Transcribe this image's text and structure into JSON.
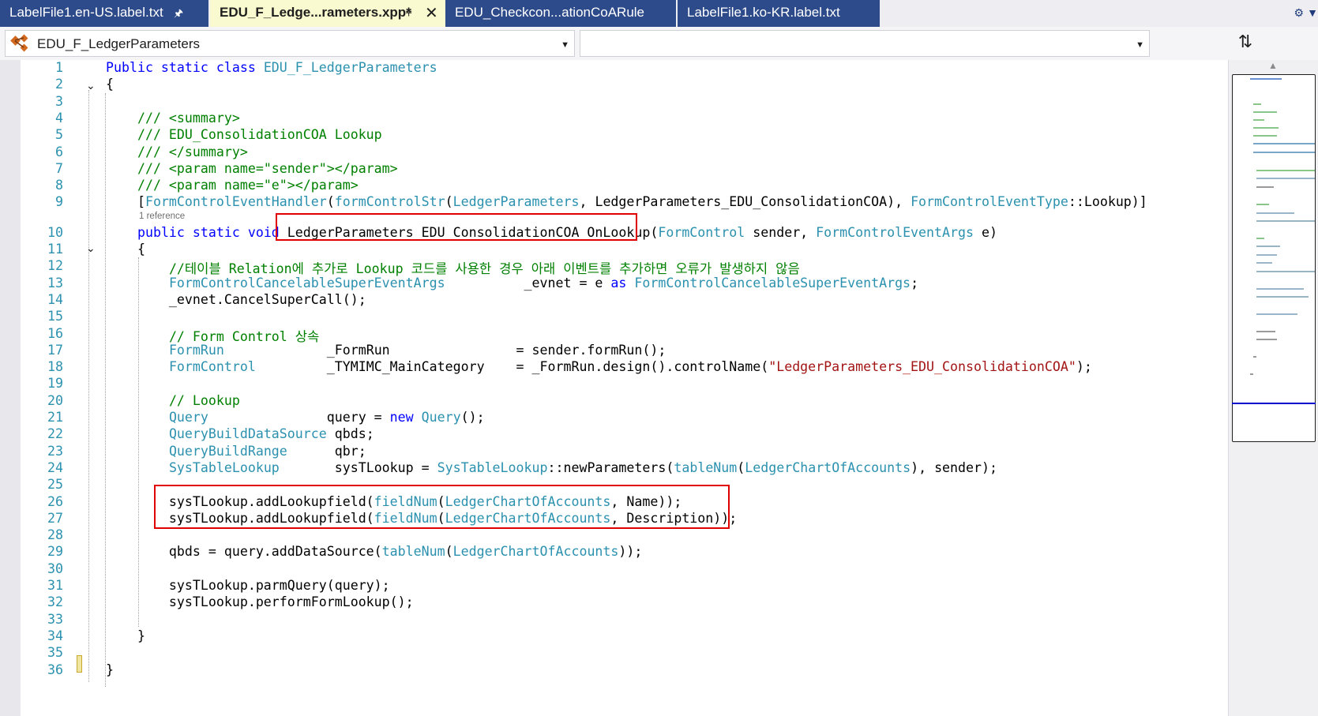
{
  "tabs": [
    {
      "label": "LabelFile1.en-US.label.txt",
      "pinned": true,
      "active": false
    },
    {
      "label": "EDU_F_Ledge...rameters.xpp*",
      "pinned": true,
      "active": true
    },
    {
      "label": "EDU_Checkcon...ationCoARule",
      "pinned": false,
      "active": false
    },
    {
      "label": "LabelFile1.ko-KR.label.txt",
      "pinned": false,
      "active": false
    }
  ],
  "navbar": {
    "type_combo": "EDU_F_LedgerParameters",
    "member_combo": ""
  },
  "code": {
    "reference_label": "1 reference",
    "lines": [
      {
        "n": "1",
        "segs": [
          [
            "kw",
            "Public static class "
          ],
          [
            "ty",
            "EDU_F_LedgerParameters"
          ]
        ]
      },
      {
        "n": "2",
        "segs": [
          [
            "",
            "{"
          ]
        ]
      },
      {
        "n": "3",
        "segs": []
      },
      {
        "n": "4",
        "segs": [
          [
            "",
            "    "
          ],
          [
            "cm",
            "/// <summary>"
          ]
        ]
      },
      {
        "n": "5",
        "segs": [
          [
            "",
            "    "
          ],
          [
            "cm",
            "/// EDU_ConsolidationCOA Lookup"
          ]
        ]
      },
      {
        "n": "6",
        "segs": [
          [
            "",
            "    "
          ],
          [
            "cm",
            "/// </summary>"
          ]
        ]
      },
      {
        "n": "7",
        "segs": [
          [
            "",
            "    "
          ],
          [
            "cm",
            "/// <param name=\"sender\"></param>"
          ]
        ]
      },
      {
        "n": "8",
        "segs": [
          [
            "",
            "    "
          ],
          [
            "cm",
            "/// <param name=\"e\"></param>"
          ]
        ]
      },
      {
        "n": "9",
        "segs": [
          [
            "",
            "    ["
          ],
          [
            "ty",
            "FormControlEventHandler"
          ],
          [
            "",
            "("
          ],
          [
            "ty",
            "formControlStr"
          ],
          [
            "",
            "("
          ],
          [
            "ty",
            "LedgerParameters"
          ],
          [
            "",
            ", LedgerParameters_EDU_ConsolidationCOA), "
          ],
          [
            "ty",
            "FormControlEventType"
          ],
          [
            "",
            "::Lookup)]"
          ]
        ]
      },
      {
        "n": "10",
        "segs": [
          [
            "",
            "    "
          ],
          [
            "kw",
            "public static void "
          ],
          [
            "",
            "LedgerParameters_EDU_ConsolidationCOA_OnLookup("
          ],
          [
            "ty",
            "FormControl"
          ],
          [
            "",
            " sender, "
          ],
          [
            "ty",
            "FormControlEventArgs"
          ],
          [
            "",
            " e)"
          ]
        ]
      },
      {
        "n": "11",
        "segs": [
          [
            "",
            "    {"
          ]
        ]
      },
      {
        "n": "12",
        "segs": [
          [
            "",
            "        "
          ],
          [
            "cm",
            "//테이블 Relation에 추가로 Lookup 코드를 사용한 경우 아래 이벤트를 추가하면 오류가 발생하지 않음"
          ]
        ]
      },
      {
        "n": "13",
        "segs": [
          [
            "",
            "        "
          ],
          [
            "ty",
            "FormControlCancelableSuperEventArgs"
          ],
          [
            "",
            "          _evnet = e "
          ],
          [
            "kw",
            "as "
          ],
          [
            "ty",
            "FormControlCancelableSuperEventArgs"
          ],
          [
            "",
            ";"
          ]
        ]
      },
      {
        "n": "14",
        "segs": [
          [
            "",
            "        _evnet.CancelSuperCall();"
          ]
        ]
      },
      {
        "n": "15",
        "segs": []
      },
      {
        "n": "16",
        "segs": [
          [
            "",
            "        "
          ],
          [
            "cm",
            "// Form Control 상속"
          ]
        ]
      },
      {
        "n": "17",
        "segs": [
          [
            "",
            "        "
          ],
          [
            "ty",
            "FormRun"
          ],
          [
            "",
            "             _FormRun                = sender.formRun();"
          ]
        ]
      },
      {
        "n": "18",
        "segs": [
          [
            "",
            "        "
          ],
          [
            "ty",
            "FormControl"
          ],
          [
            "",
            "         _TYMIMC_MainCategory    = _FormRun.design().controlName("
          ],
          [
            "str",
            "\"LedgerParameters_EDU_ConsolidationCOA\""
          ],
          [
            "",
            ");"
          ]
        ]
      },
      {
        "n": "19",
        "segs": []
      },
      {
        "n": "20",
        "segs": [
          [
            "",
            "        "
          ],
          [
            "cm",
            "// Lookup"
          ]
        ]
      },
      {
        "n": "21",
        "segs": [
          [
            "",
            "        "
          ],
          [
            "ty",
            "Query"
          ],
          [
            "",
            "               query = "
          ],
          [
            "kw",
            "new "
          ],
          [
            "ty",
            "Query"
          ],
          [
            "",
            "();"
          ]
        ]
      },
      {
        "n": "22",
        "segs": [
          [
            "",
            "        "
          ],
          [
            "ty",
            "QueryBuildDataSource"
          ],
          [
            "",
            " qbds;"
          ]
        ]
      },
      {
        "n": "23",
        "segs": [
          [
            "",
            "        "
          ],
          [
            "ty",
            "QueryBuildRange"
          ],
          [
            "",
            "      qbr;"
          ]
        ]
      },
      {
        "n": "24",
        "segs": [
          [
            "",
            "        "
          ],
          [
            "ty",
            "SysTableLookup"
          ],
          [
            "",
            "       sysTLookup = "
          ],
          [
            "ty",
            "SysTableLookup"
          ],
          [
            "",
            "::newParameters("
          ],
          [
            "ty",
            "tableNum"
          ],
          [
            "",
            "("
          ],
          [
            "ty",
            "LedgerChartOfAccounts"
          ],
          [
            "",
            "), sender);"
          ]
        ]
      },
      {
        "n": "25",
        "segs": []
      },
      {
        "n": "26",
        "segs": [
          [
            "",
            "        sysTLookup.addLookupfield("
          ],
          [
            "ty",
            "fieldNum"
          ],
          [
            "",
            "("
          ],
          [
            "ty",
            "LedgerChartOfAccounts"
          ],
          [
            "",
            ", Name));"
          ]
        ]
      },
      {
        "n": "27",
        "segs": [
          [
            "",
            "        sysTLookup.addLookupfield("
          ],
          [
            "ty",
            "fieldNum"
          ],
          [
            "",
            "("
          ],
          [
            "ty",
            "LedgerChartOfAccounts"
          ],
          [
            "",
            ", Description));"
          ]
        ]
      },
      {
        "n": "28",
        "segs": []
      },
      {
        "n": "29",
        "segs": [
          [
            "",
            "        qbds = query.addDataSource("
          ],
          [
            "ty",
            "tableNum"
          ],
          [
            "",
            "("
          ],
          [
            "ty",
            "LedgerChartOfAccounts"
          ],
          [
            "",
            "));"
          ]
        ]
      },
      {
        "n": "30",
        "segs": []
      },
      {
        "n": "31",
        "segs": [
          [
            "",
            "        sysTLookup.parmQuery(query);"
          ]
        ]
      },
      {
        "n": "32",
        "segs": [
          [
            "",
            "        sysTLookup.performFormLookup();"
          ]
        ]
      },
      {
        "n": "33",
        "segs": []
      },
      {
        "n": "34",
        "segs": [
          [
            "",
            "    }"
          ]
        ]
      },
      {
        "n": "35",
        "segs": []
      },
      {
        "n": "36",
        "segs": [
          [
            "",
            "}"
          ]
        ]
      }
    ]
  }
}
